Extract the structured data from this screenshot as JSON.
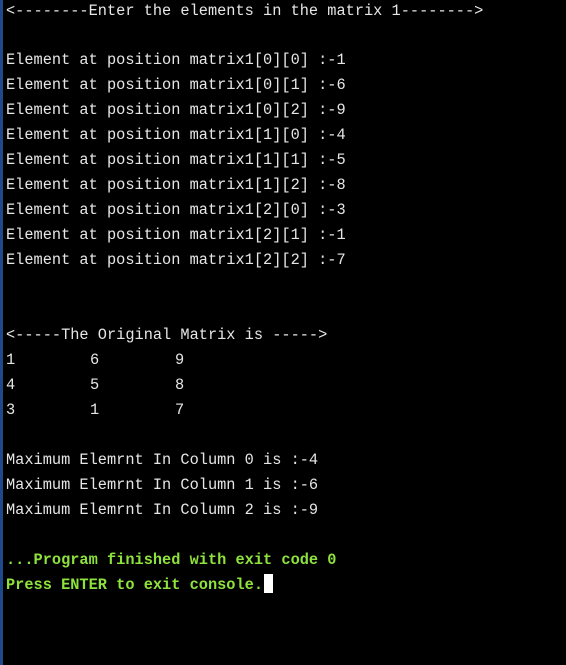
{
  "console": {
    "header": "<--------Enter the elements in the matrix 1-------->",
    "inputs": [
      "Element at position matrix1[0][0] :-1",
      "Element at position matrix1[0][1] :-6",
      "Element at position matrix1[0][2] :-9",
      "Element at position matrix1[1][0] :-4",
      "Element at position matrix1[1][1] :-5",
      "Element at position matrix1[1][2] :-8",
      "Element at position matrix1[2][0] :-3",
      "Element at position matrix1[2][1] :-1",
      "Element at position matrix1[2][2] :-7"
    ],
    "matrix_title": "<-----The Original Matrix is ----->",
    "matrix": [
      [
        "1",
        "6",
        "9"
      ],
      [
        "4",
        "5",
        "8"
      ],
      [
        "3",
        "1",
        "7"
      ]
    ],
    "max_lines": [
      "Maximum Elemrnt In Column 0 is :-4",
      "Maximum Elemrnt In Column 1 is :-6",
      "Maximum Elemrnt In Column 2 is :-9"
    ],
    "exit_message": "...Program finished with exit code 0",
    "press_enter": "Press ENTER to exit console."
  },
  "colors": {
    "background": "#000000",
    "text": "#e6e6e6",
    "status_text": "#8ee23c",
    "left_border": "#1e4a8c",
    "cursor": "#ffffff"
  }
}
